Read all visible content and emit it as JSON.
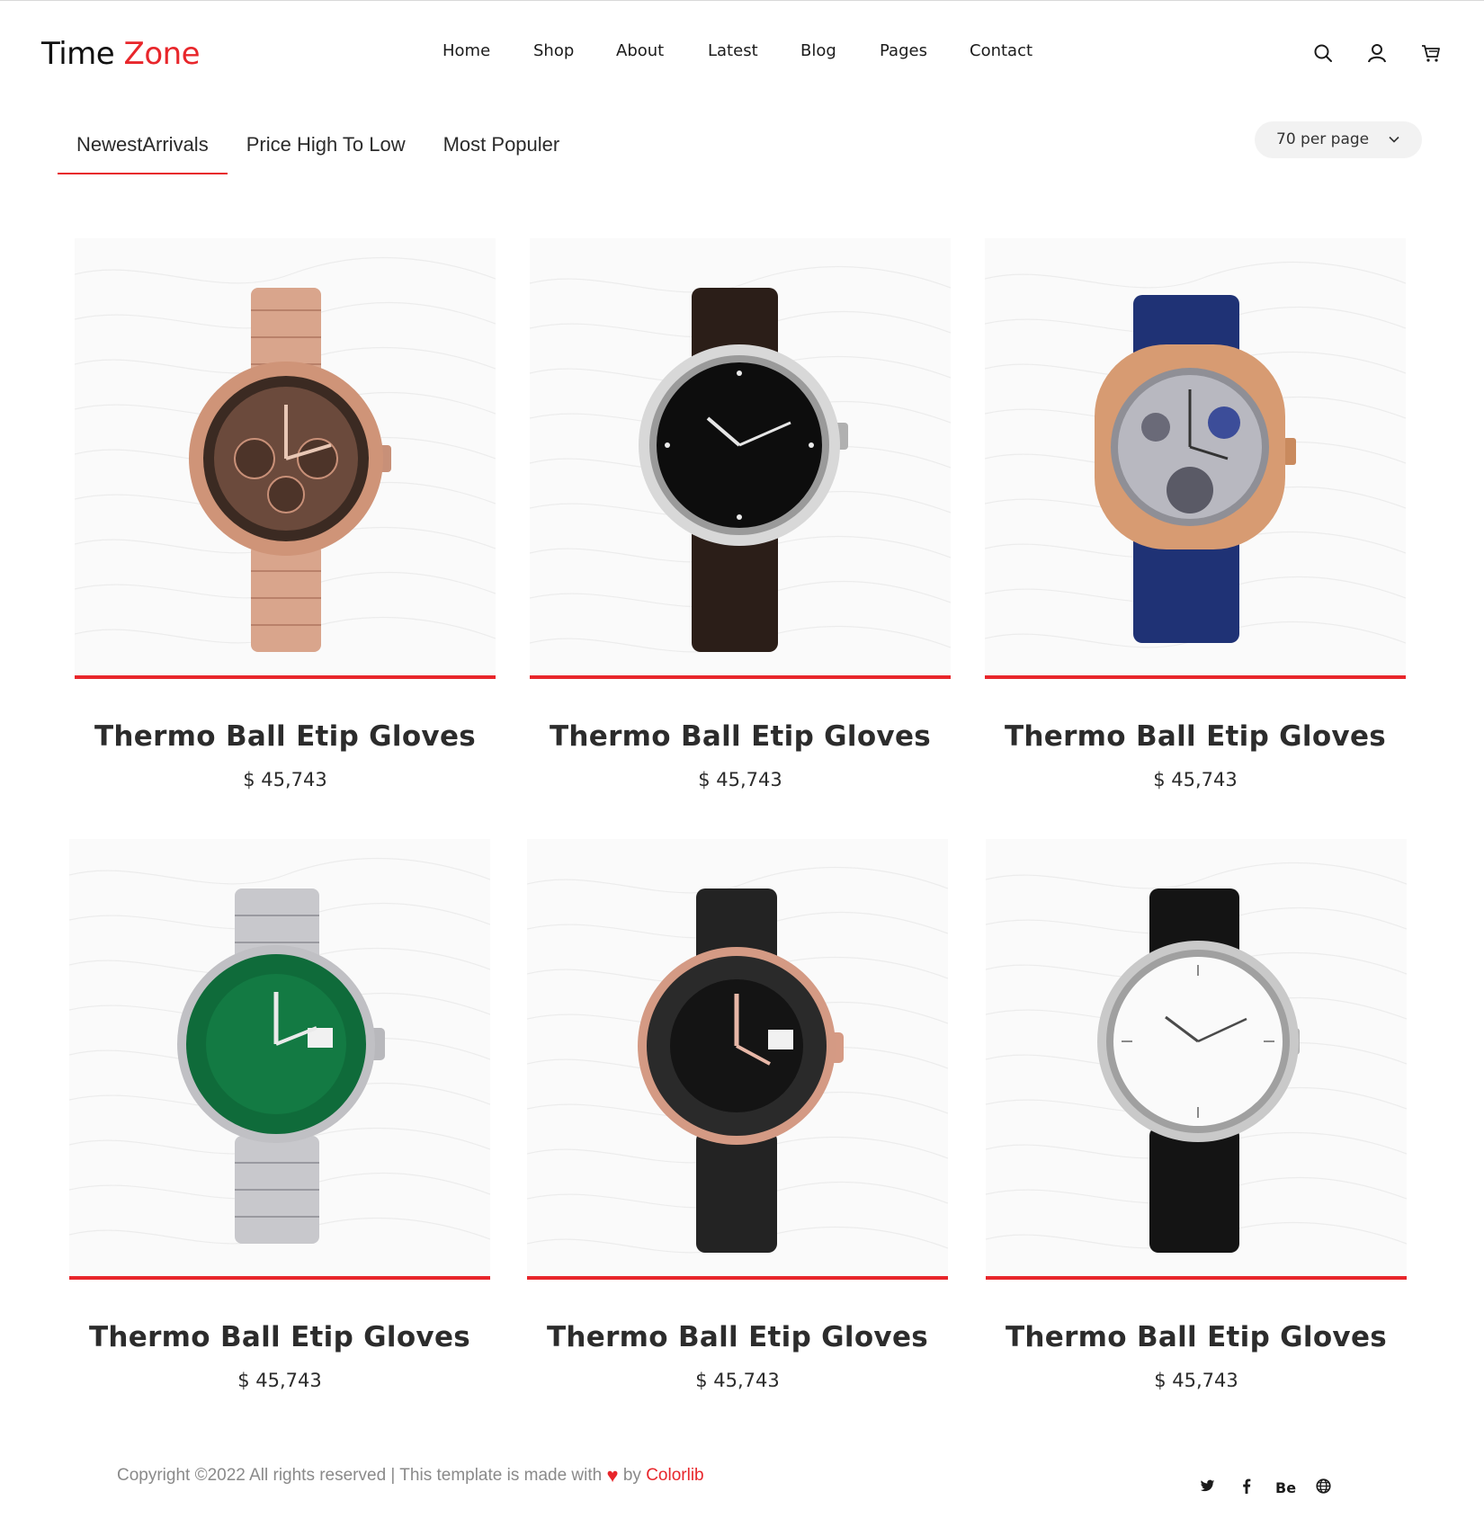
{
  "brand": {
    "part1": "Time",
    "part2": "Zone"
  },
  "nav": [
    "Home",
    "Shop",
    "About",
    "Latest",
    "Blog",
    "Pages",
    "Contact"
  ],
  "header_icons": [
    "search-icon",
    "user-icon",
    "cart-icon"
  ],
  "tabs": [
    "NewestArrivals",
    "Price High To Low",
    "Most Populer"
  ],
  "active_tab": "NewestArrivals",
  "per_page": "70 per page",
  "products": [
    {
      "title": "Thermo Ball Etip Gloves",
      "price": "$ 45,743",
      "watch": "rose-gold-chronograph"
    },
    {
      "title": "Thermo Ball Etip Gloves",
      "price": "$ 45,743",
      "watch": "black-dial-leather"
    },
    {
      "title": "Thermo Ball Etip Gloves",
      "price": "$ 45,743",
      "watch": "skeleton-blue-strap"
    },
    {
      "title": "Thermo Ball Etip Gloves",
      "price": "$ 45,743",
      "watch": "green-submariner"
    },
    {
      "title": "Thermo Ball Etip Gloves",
      "price": "$ 45,743",
      "watch": "everose-rubber"
    },
    {
      "title": "Thermo Ball Etip Gloves",
      "price": "$ 45,743",
      "watch": "white-dial-leather"
    }
  ],
  "footer": {
    "copyright": "Copyright ©2022 All rights reserved | This template is made with",
    "by": "by",
    "link": "Colorlib"
  },
  "social": [
    "Be"
  ],
  "colors": {
    "accent": "#e8262b",
    "text": "#2c2c2c"
  }
}
